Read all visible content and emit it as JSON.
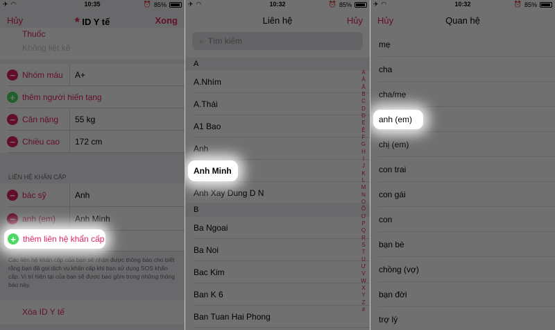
{
  "status": [
    {
      "time": "10:35",
      "battery": "85%"
    },
    {
      "time": "10:32",
      "battery": "85%"
    },
    {
      "time": "10:32",
      "battery": "85%"
    }
  ],
  "panel1": {
    "nav_left": "Hủy",
    "nav_title": "ID Y tế",
    "nav_title_glyph": "*",
    "nav_right": "Xong",
    "top_label": "Thuốc",
    "top_value_placeholder": "Không liệt kê",
    "fields": [
      {
        "label": "Nhóm máu",
        "value": "A+"
      },
      {
        "label": "thêm người hiến tạng",
        "value": ""
      },
      {
        "label": "Cân nặng",
        "value": "55 kg"
      },
      {
        "label": "Chiều cao",
        "value": "172 cm"
      }
    ],
    "section_header": "LIÊN HỆ KHẨN CẤP",
    "contacts": [
      {
        "label": "bác sỹ",
        "value": "Anh"
      },
      {
        "label": "anh (em)",
        "value": "Anh Minh"
      }
    ],
    "add_contact": "thêm liên hệ khẩn cấp",
    "note": "Các liên hệ khẩn cấp của bạn sẽ nhận được thông báo cho biết rằng bạn đã gọi dịch vụ khẩn cấp khi bạn sử dụng SOS khẩn cấp. Vị trí hiện tại của bạn sẽ được bao gồm trong những thông báo này.",
    "delete": "Xóa ID Y tế",
    "colors": {
      "accent": "#e0245e",
      "plus": "#4cd964"
    }
  },
  "panel2": {
    "nav_title": "Liên hệ",
    "nav_right": "Hủy",
    "search_placeholder": "Tìm kiếm",
    "section_a": "A",
    "contacts_a": [
      "A.Nhím",
      "A.Thái",
      "A1 Bao",
      "Anh",
      "Anh Minh",
      "Anh Xay Dung D N"
    ],
    "section_b": "B",
    "contacts_b": [
      "Ba Ngoai",
      "Ba Noi",
      "Bac Kim",
      "Ban K 6",
      "Ban Tuan Hai Phong"
    ],
    "index": [
      "A",
      "Ă",
      "Â",
      "B",
      "C",
      "D",
      "Đ",
      "E",
      "Ê",
      "F",
      "G",
      "H",
      "I",
      "J",
      "K",
      "L",
      "M",
      "N",
      "O",
      "Ô",
      "Ơ",
      "P",
      "Q",
      "R",
      "S",
      "T",
      "U",
      "Ư",
      "V",
      "W",
      "X",
      "Y",
      "Z",
      "#"
    ]
  },
  "panel3": {
    "nav_left": "Hủy",
    "nav_title": "Quan hệ",
    "relations": [
      "mẹ",
      "cha",
      "cha/mẹ",
      "anh (em)",
      "chị (em)",
      "con trai",
      "con gái",
      "con",
      "bạn bè",
      "chồng (vợ)",
      "bạn đời",
      "trợ lý"
    ]
  }
}
